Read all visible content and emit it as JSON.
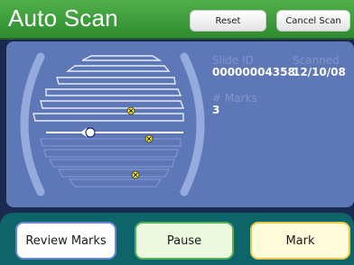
{
  "header": {
    "title": "Auto Scan",
    "reset_label": "Reset",
    "cancel_label": "Cancel Scan"
  },
  "slide_info": {
    "slide_id_label": "Slide ID",
    "slide_id_value": "00000004358",
    "scanned_label": "Scanned",
    "scanned_value": "12/10/08",
    "marks_label": "# Marks",
    "marks_value": "3"
  },
  "footer": {
    "review_label": "Review Marks",
    "pause_label": "Pause",
    "mark_label": "Mark"
  },
  "colors": {
    "header_green": "#3f9e3f",
    "panel_blue": "#5e78b7",
    "footer_teal": "#0d6469",
    "mark_yellow": "#f2e21a"
  },
  "icons": {
    "mark": "x-marker-icon",
    "position": "scan-position-icon"
  }
}
